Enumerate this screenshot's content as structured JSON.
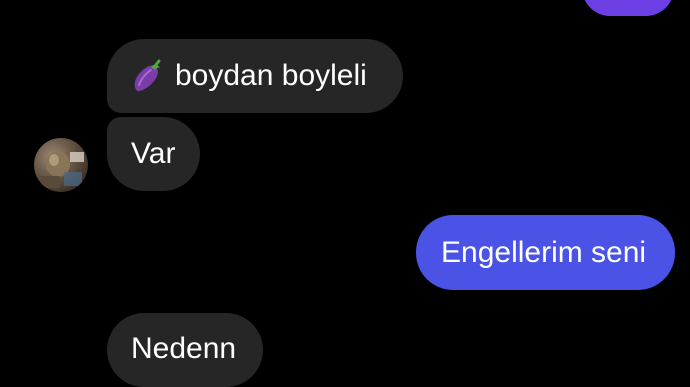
{
  "messages": [
    {
      "from": "them",
      "text": "boydan boyleli",
      "emoji": "eggplant-icon"
    },
    {
      "from": "them",
      "text": "Var"
    },
    {
      "from": "me",
      "text": "Engellerim seni"
    },
    {
      "from": "them",
      "text": "Nedenn"
    }
  ],
  "colors": {
    "background": "#000000",
    "incoming_bubble": "#262626",
    "outgoing_bubble": "#4a53e6",
    "top_outgoing_bubble": "#6b3fe3",
    "text": "#ffffff"
  }
}
